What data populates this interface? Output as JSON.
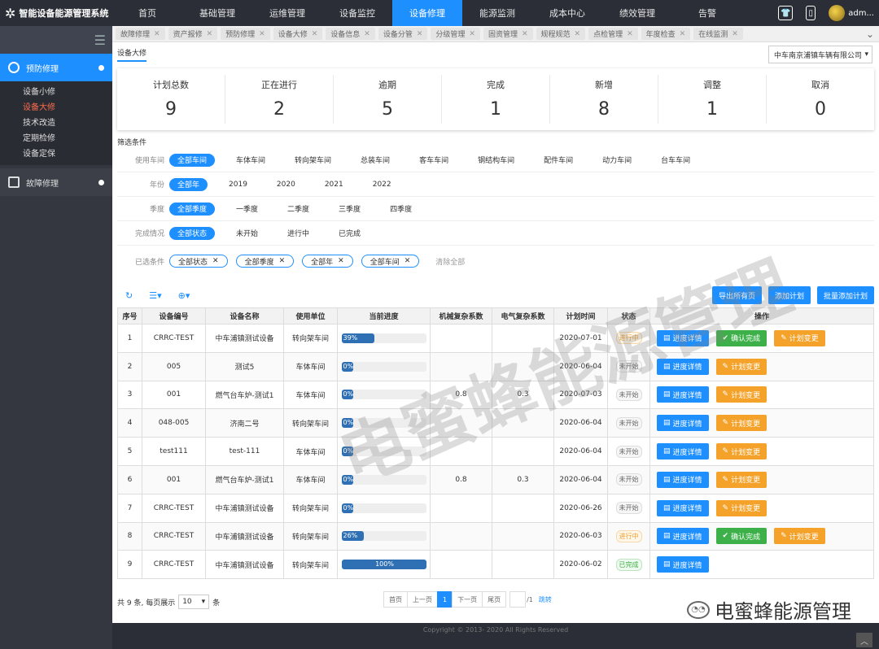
{
  "app": {
    "title": "智能设备能源管理系统",
    "user": "adm..."
  },
  "nav": [
    "首页",
    "基础管理",
    "运维管理",
    "设备监控",
    "设备修理",
    "能源监测",
    "成本中心",
    "绩效管理",
    "告警"
  ],
  "sidebar": {
    "group1": "预防修理",
    "items": [
      "设备小修",
      "设备大修",
      "技术改造",
      "定期检修",
      "设备定保"
    ],
    "group2": "故障修理"
  },
  "tabs": [
    "故障修理",
    "资产报修",
    "预防修理",
    "设备大修",
    "设备信息",
    "设备分管",
    "分级管理",
    "固资管理",
    "规程规范",
    "点检管理",
    "年度检查",
    "在线监测"
  ],
  "breadcrumb": "设备大修",
  "company": "中车南京浦镇车辆有限公司",
  "stats": [
    {
      "label": "计划总数",
      "value": "9"
    },
    {
      "label": "正在进行",
      "value": "2"
    },
    {
      "label": "逾期",
      "value": "5"
    },
    {
      "label": "完成",
      "value": "1"
    },
    {
      "label": "新增",
      "value": "8"
    },
    {
      "label": "调整",
      "value": "1"
    },
    {
      "label": "取消",
      "value": "0"
    }
  ],
  "filter_title": "筛选条件",
  "filters": {
    "workshop": {
      "label": "使用车间",
      "options": [
        "全部车间",
        "车体车间",
        "转向架车间",
        "总装车间",
        "客车车间",
        "钢结构车间",
        "配件车间",
        "动力车间",
        "台车车间"
      ]
    },
    "year": {
      "label": "年份",
      "options": [
        "全部年",
        "2019",
        "2020",
        "2021",
        "2022"
      ]
    },
    "quarter": {
      "label": "季度",
      "options": [
        "全部季度",
        "一季度",
        "二季度",
        "三季度",
        "四季度"
      ]
    },
    "status": {
      "label": "完成情况",
      "options": [
        "全部状态",
        "未开始",
        "进行中",
        "已完成"
      ]
    },
    "selected": {
      "label": "已选条件",
      "chips": [
        "全部状态",
        "全部季度",
        "全部年",
        "全部车间"
      ],
      "clear": "清除全部"
    }
  },
  "toolbar": {
    "export": "导出所有页",
    "add": "添加计划",
    "batch": "批量添加计划"
  },
  "table": {
    "headers": [
      "序号",
      "设备编号",
      "设备名称",
      "使用单位",
      "当前进度",
      "机械复杂系数",
      "电气复杂系数",
      "计划时间",
      "状态",
      "操作"
    ],
    "rows": [
      {
        "no": "1",
        "code": "CRRC-TEST",
        "name": "中车浦镇测试设备",
        "unit": "转向架车间",
        "progress": 39,
        "mech": "",
        "elec": "",
        "date": "2020-07-01",
        "status": "进行中",
        "st": "ing",
        "ops": [
          "进度详情",
          "确认完成",
          "计划变更"
        ]
      },
      {
        "no": "2",
        "code": "005",
        "name": "测试5",
        "unit": "车体车间",
        "progress": 0,
        "mech": "",
        "elec": "",
        "date": "2020-06-04",
        "status": "未开始",
        "st": "",
        "ops": [
          "进度详情",
          "计划变更"
        ]
      },
      {
        "no": "3",
        "code": "001",
        "name": "燃气台车炉-测试1",
        "unit": "车体车间",
        "progress": 0,
        "mech": "0.8",
        "elec": "0.3",
        "date": "2020-07-03",
        "status": "未开始",
        "st": "",
        "ops": [
          "进度详情",
          "计划变更"
        ]
      },
      {
        "no": "4",
        "code": "048-005",
        "name": "济南二号",
        "unit": "转向架车间",
        "progress": 0,
        "mech": "",
        "elec": "",
        "date": "2020-06-04",
        "status": "未开始",
        "st": "",
        "ops": [
          "进度详情",
          "计划变更"
        ]
      },
      {
        "no": "5",
        "code": "test111",
        "name": "test-111",
        "unit": "车体车间",
        "progress": 0,
        "mech": "",
        "elec": "",
        "date": "2020-06-04",
        "status": "未开始",
        "st": "",
        "ops": [
          "进度详情",
          "计划变更"
        ]
      },
      {
        "no": "6",
        "code": "001",
        "name": "燃气台车炉-测试1",
        "unit": "车体车间",
        "progress": 0,
        "mech": "0.8",
        "elec": "0.3",
        "date": "2020-06-04",
        "status": "未开始",
        "st": "",
        "ops": [
          "进度详情",
          "计划变更"
        ]
      },
      {
        "no": "7",
        "code": "CRRC-TEST",
        "name": "中车浦镇测试设备",
        "unit": "转向架车间",
        "progress": 0,
        "mech": "",
        "elec": "",
        "date": "2020-06-26",
        "status": "未开始",
        "st": "",
        "ops": [
          "进度详情",
          "计划变更"
        ]
      },
      {
        "no": "8",
        "code": "CRRC-TEST",
        "name": "中车浦镇测试设备",
        "unit": "转向架车间",
        "progress": 26,
        "mech": "",
        "elec": "",
        "date": "2020-06-03",
        "status": "进行中",
        "st": "ing",
        "ops": [
          "进度详情",
          "确认完成",
          "计划变更"
        ]
      },
      {
        "no": "9",
        "code": "CRRC-TEST",
        "name": "中车浦镇测试设备",
        "unit": "转向架车间",
        "progress": 100,
        "mech": "",
        "elec": "",
        "date": "2020-06-02",
        "status": "已完成",
        "st": "done",
        "ops": [
          "进度详情"
        ]
      }
    ]
  },
  "footer": {
    "total": "共 9 条,",
    "per_page": "每页展示",
    "page_size": "10",
    "unit": "条",
    "pager": [
      "首页",
      "上一页",
      "1",
      "下一页",
      "尾页"
    ],
    "of": "/1",
    "go": "跳转"
  },
  "copyright": "Copyright © 2013- 2020 All Rights Reserved",
  "watermark": "电蜜蜂能源管理",
  "wechat": "电蜜蜂能源管理"
}
